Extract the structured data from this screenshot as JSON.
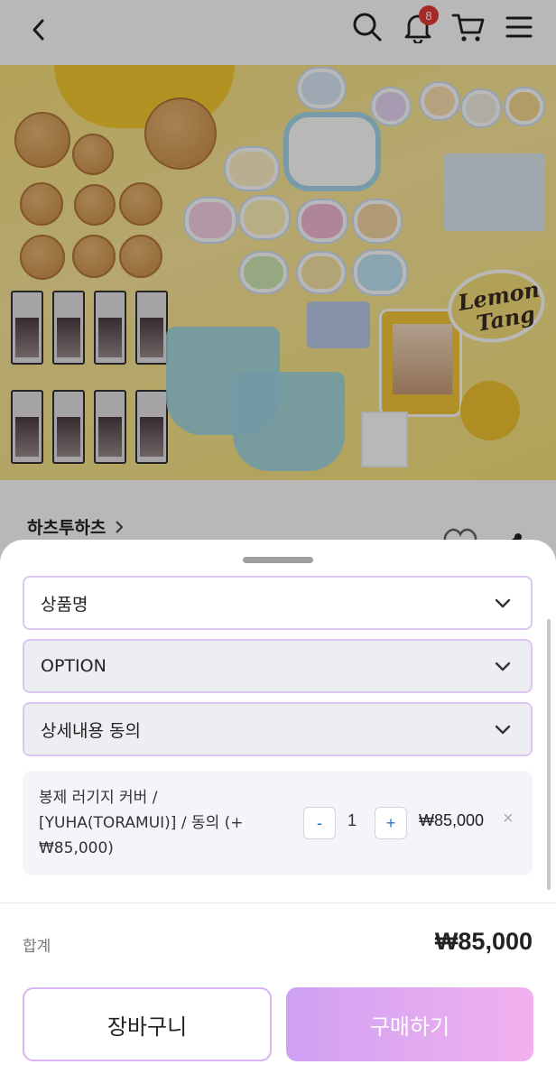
{
  "header": {
    "notification_count": "8",
    "icons": [
      "back-icon",
      "search-icon",
      "bell-icon",
      "cart-icon",
      "menu-icon"
    ]
  },
  "hero": {
    "logo_text": "Lemon Tang"
  },
  "seller": {
    "name": "하츠투하츠"
  },
  "sheet": {
    "select_product_label": "상품명",
    "select_option_label": "OPTION",
    "select_agree_label": "상세내용 동의",
    "item": {
      "description": "봉제 러기지 커버 / [YUHA(TORAMUI)] / 동의 (+ ₩85,000)",
      "minus": "-",
      "quantity": "1",
      "plus": "+",
      "price": "₩85,000",
      "remove": "×"
    },
    "total_label": "합계",
    "total_value": "₩85,000",
    "cart_button": "장바구니",
    "buy_button": "구매하기"
  },
  "colors": {
    "accent_border": "#dcc7f3",
    "buy_gradient_start": "#cfa1f3",
    "buy_gradient_end": "#f2b1ee",
    "badge": "#e53935"
  }
}
